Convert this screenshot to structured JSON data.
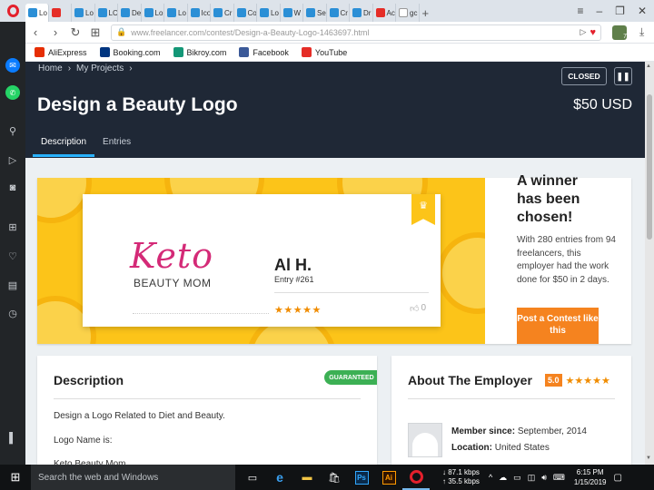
{
  "browser": {
    "tabs": [
      {
        "label": "Lo",
        "fav": "fl"
      },
      {
        "label": "",
        "fav": "yt"
      },
      {
        "label": "Lo",
        "fav": "fl"
      },
      {
        "label": "LC",
        "fav": "fl"
      },
      {
        "label": "De",
        "fav": "fl"
      },
      {
        "label": "Lo",
        "fav": "fl"
      },
      {
        "label": "Lo",
        "fav": "fl"
      },
      {
        "label": "Ico",
        "fav": "fl"
      },
      {
        "label": "Cr",
        "fav": "fl"
      },
      {
        "label": "Co",
        "fav": "fl"
      },
      {
        "label": "Lo",
        "fav": "fl"
      },
      {
        "label": "W",
        "fav": "fl"
      },
      {
        "label": "Se",
        "fav": "fl"
      },
      {
        "label": "Cr",
        "fav": "fl"
      },
      {
        "label": "Dr",
        "fav": "fl"
      },
      {
        "label": "Ac",
        "fav": "yt"
      },
      {
        "label": "gc",
        "fav": "g"
      }
    ],
    "url_host": "www.freelancer.com",
    "url_path": "/contest/Design-a-Beauty-Logo-1463697.html",
    "extension_badge": "7",
    "bookmarks": [
      {
        "label": "AliExpress",
        "color": "#e62e04"
      },
      {
        "label": "Booking.com",
        "color": "#003580"
      },
      {
        "label": "Bikroy.com",
        "color": "#149777"
      },
      {
        "label": "Facebook",
        "color": "#3b5998"
      },
      {
        "label": "YouTube",
        "color": "#e52d27"
      }
    ]
  },
  "page": {
    "breadcrumbs": [
      "Home",
      "My Projects"
    ],
    "status_button": "CLOSED",
    "title": "Design a Beauty Logo",
    "prize": "$50 USD",
    "tabs": [
      "Description",
      "Entries"
    ],
    "winner_entry": {
      "logo_text": "Keto",
      "logo_subtext": "BEAUTY MOM",
      "name": "Al H.",
      "entry": "Entry #261",
      "stars": "★★★★★",
      "likes": "0"
    },
    "winner_heading_lines": [
      "A winner",
      "has been",
      "chosen!"
    ],
    "winner_description": "With 280 entries from 94 freelancers, this employer had the work done for $50 in 2 days.",
    "post_button": "Post a Contest like this",
    "description_card": {
      "title": "Description",
      "badge": "GUARANTEED",
      "paragraphs": [
        "Design a Logo Related to Diet and Beauty.",
        "Logo Name is:",
        "Keto Beauty Mom"
      ]
    },
    "employer_card": {
      "title": "About The Employer",
      "rating": "5.0",
      "stars": "★★★★★",
      "member_since_label": "Member since:",
      "member_since_value": "September, 2014",
      "location_label": "Location:",
      "location_value": "United States"
    }
  },
  "taskbar": {
    "search_placeholder": "Search the web and Windows",
    "net_down": "87.1 kbps",
    "net_up": "35.5 kbps",
    "time": "6:15 PM",
    "date": "1/15/2019",
    "ps_label": "Ps",
    "ai_label": "Ai"
  }
}
